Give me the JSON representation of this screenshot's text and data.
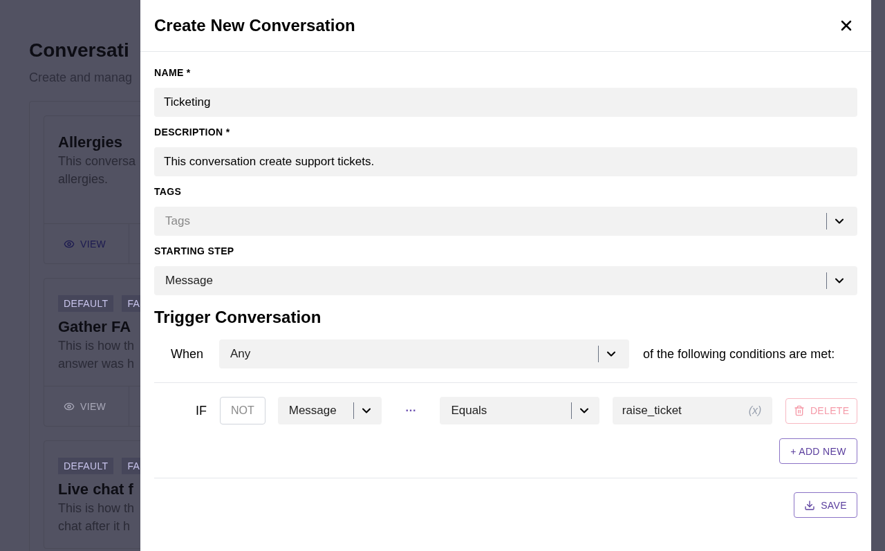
{
  "page": {
    "title": "Conversati",
    "subtitle": "Create and manag"
  },
  "cards": [
    {
      "title": "Allergies",
      "lines": [
        "This conversa",
        "allergies."
      ],
      "action": "VIEW",
      "disabled": false
    },
    {
      "tags": [
        "DEFAULT",
        "FA"
      ],
      "title": "Gather FA",
      "lines": [
        "This is how th",
        "answer was h"
      ],
      "action": "VIEW",
      "disabled": true
    },
    {
      "tags": [
        "DEFAULT",
        "FA"
      ],
      "title": "Live chat f",
      "lines": [
        "This is how th",
        "chat after it h"
      ]
    }
  ],
  "dialog": {
    "title": "Create New Conversation",
    "fields": [
      {
        "kind": "text",
        "label": "NAME *",
        "value": "Ticketing"
      },
      {
        "kind": "text",
        "label": "DESCRIPTION *",
        "value": "This conversation create support tickets."
      },
      {
        "kind": "select",
        "label": "TAGS",
        "placeholder": "Tags"
      },
      {
        "kind": "select",
        "label": "STARTING STEP",
        "value": "Message"
      }
    ],
    "trigger": {
      "heading": "Trigger Conversation",
      "when_label": "When",
      "match": "Any",
      "suffix": "of the following conditions are met:",
      "conditions": [
        {
          "if_label": "IF",
          "not_label": "NOT",
          "not": false,
          "field": "Message",
          "more": "···",
          "operator": "Equals",
          "value": "raise_ticket",
          "variable": "(x)",
          "delete": "DELETE"
        }
      ],
      "add_button": "+ ADD NEW"
    },
    "save_button": "SAVE"
  }
}
